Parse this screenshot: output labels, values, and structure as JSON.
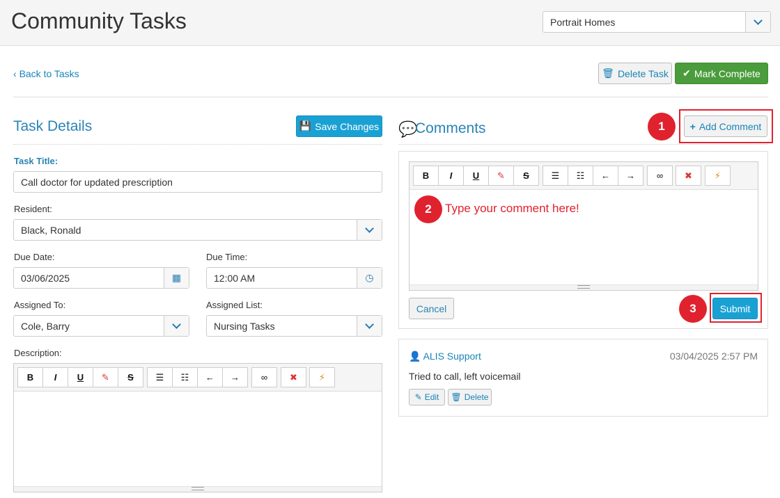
{
  "header": {
    "title": "Community Tasks",
    "community_select": "Portrait Homes"
  },
  "actions": {
    "back": "Back to Tasks",
    "delete_task": "Delete Task",
    "mark_complete": "Mark Complete"
  },
  "task_details": {
    "heading": "Task Details",
    "save_changes": "Save Changes",
    "task_title_label": "Task Title:",
    "task_title_value": "Call doctor for updated prescription",
    "resident_label": "Resident:",
    "resident_value": "Black, Ronald",
    "due_date_label": "Due Date:",
    "due_date_value": "03/06/2025",
    "due_time_label": "Due Time:",
    "due_time_value": "12:00 AM",
    "assigned_to_label": "Assigned To:",
    "assigned_to_value": "Cole, Barry",
    "assigned_list_label": "Assigned List:",
    "assigned_list_value": "Nursing Tasks",
    "description_label": "Description:"
  },
  "editor_toolbar": {
    "bold": "B",
    "italic": "I",
    "underline": "U",
    "eraser": "✎",
    "strike": "S",
    "bullets": "☰",
    "numbered": "☷",
    "outdent": "←",
    "indent": "→",
    "link": "∞",
    "remove": "✖",
    "magic": "⚡"
  },
  "comments": {
    "heading": "Comments",
    "add_comment": "Add Comment",
    "placeholder": "Type your comment here!",
    "cancel": "Cancel",
    "submit": "Submit",
    "items": [
      {
        "author": "ALIS Support",
        "date": "03/04/2025 2:57 PM",
        "text": "Tried to call, left voicemail",
        "edit": "Edit",
        "delete": "Delete"
      }
    ]
  },
  "callouts": [
    "1",
    "2",
    "3"
  ],
  "colors": {
    "accent": "#2a84b5",
    "success": "#4b9c3c",
    "primary": "#1aa1d4",
    "callout": "#e0222e"
  }
}
